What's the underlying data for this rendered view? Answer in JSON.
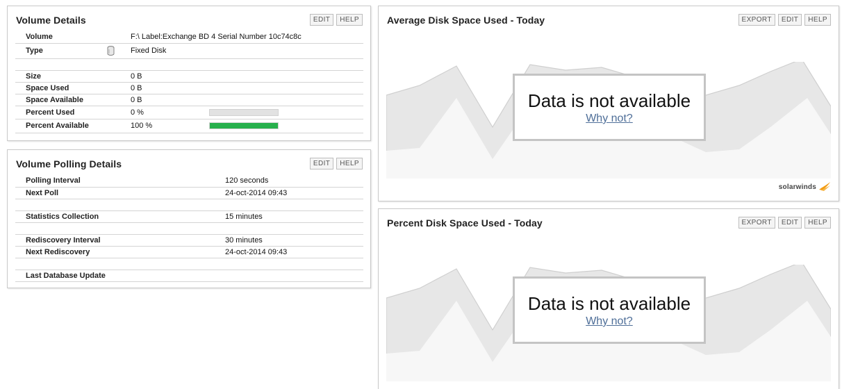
{
  "volume_details": {
    "title": "Volume Details",
    "buttons": {
      "edit": "EDIT",
      "help": "HELP"
    },
    "volume_label": "Volume",
    "volume_value": "F:\\ Label:Exchange BD 4 Serial Number 10c74c8c",
    "type_label": "Type",
    "type_value": "Fixed Disk",
    "type_icon": "disk-icon",
    "size_label": "Size",
    "size_value": "0 B",
    "space_used_label": "Space Used",
    "space_used_value": "0 B",
    "space_available_label": "Space Available",
    "space_available_value": "0 B",
    "percent_used_label": "Percent Used",
    "percent_used_value": "0 %",
    "percent_used_fraction": 0,
    "percent_available_label": "Percent Available",
    "percent_available_value": "100 %",
    "percent_available_fraction": 1,
    "bar_color": "#27b04c"
  },
  "polling_details": {
    "title": "Volume Polling Details",
    "buttons": {
      "edit": "EDIT",
      "help": "HELP"
    },
    "polling_interval_label": "Polling Interval",
    "polling_interval_value": "120 seconds",
    "next_poll_label": "Next Poll",
    "next_poll_value": "24-oct-2014 09:43",
    "statistics_label": "Statistics Collection",
    "statistics_value": "15 minutes",
    "rediscovery_interval_label": "Rediscovery Interval",
    "rediscovery_interval_value": "30 minutes",
    "next_rediscovery_label": "Next Rediscovery",
    "next_rediscovery_value": "24-oct-2014 09:43",
    "last_db_update_label": "Last Database Update",
    "last_db_update_value": ""
  },
  "avg_chart": {
    "title": "Average Disk Space Used - Today",
    "buttons": {
      "export": "EXPORT",
      "edit": "EDIT",
      "help": "HELP"
    },
    "message": "Data is not available",
    "link": "Why not?",
    "logo": "solarwinds",
    "logo_color": "#f39c12"
  },
  "pct_chart": {
    "title": "Percent Disk Space Used - Today",
    "buttons": {
      "export": "EXPORT",
      "edit": "EDIT",
      "help": "HELP"
    },
    "message": "Data is not available",
    "link": "Why not?"
  }
}
